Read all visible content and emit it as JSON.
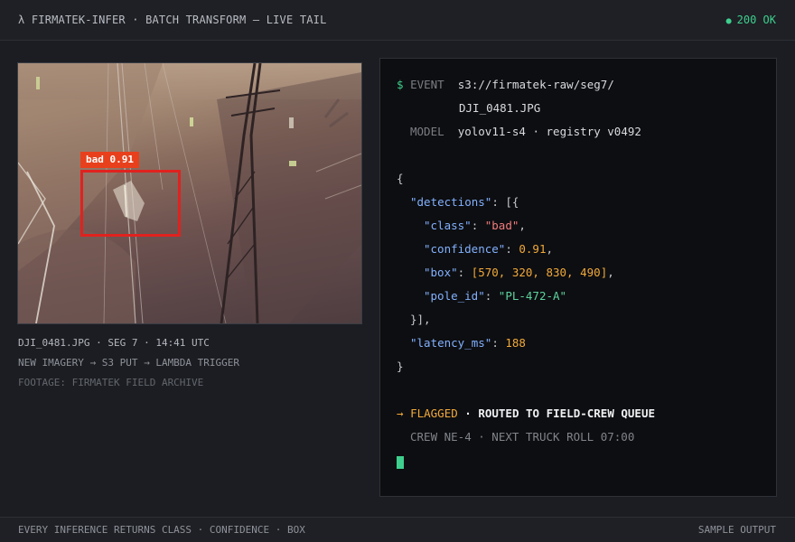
{
  "header": {
    "title": "λ FIRMATEK-INFER · BATCH TRANSFORM — LIVE TAIL",
    "status_dot": "●",
    "status": "200 OK",
    "status_color": "#3ecf8e"
  },
  "image": {
    "detection_label": "bad 0.91",
    "box_color": "#e0221f",
    "label_color": "#e8401c",
    "captions": [
      "DJI_0481.JPG · SEG 7 · 14:41 UTC",
      "NEW IMAGERY → S3 PUT → LAMBDA TRIGGER",
      "FOOTAGE: FIRMATEK FIELD ARCHIVE"
    ]
  },
  "terminal": {
    "prompt": "$",
    "event_key": "EVENT",
    "event_value_1": "s3://firmatek-raw/seg7/",
    "event_value_2": "DJI_0481.JPG",
    "model_key": "MODEL",
    "model_value": "yolov11-s4 · registry v0492",
    "json": {
      "detections_key": "\"detections\"",
      "class_key": "\"class\"",
      "class_value": "\"bad\"",
      "confidence_key": "\"confidence\"",
      "confidence_value": "0.91",
      "box_key": "\"box\"",
      "box_value": "[570, 320, 830, 490]",
      "pole_id_key": "\"pole_id\"",
      "pole_id_value": "\"PL-472-A\"",
      "latency_key": "\"latency_ms\"",
      "latency_value": "188"
    },
    "flag_arrow": "→",
    "flag_label": "FLAGGED",
    "route_text": "· ROUTED TO FIELD-CREW QUEUE",
    "crew_text": "CREW NE-4 · NEXT TRUCK ROLL 07:00"
  },
  "footer": {
    "left": "EVERY INFERENCE RETURNS CLASS · CONFIDENCE · BOX",
    "right": "SAMPLE OUTPUT"
  }
}
